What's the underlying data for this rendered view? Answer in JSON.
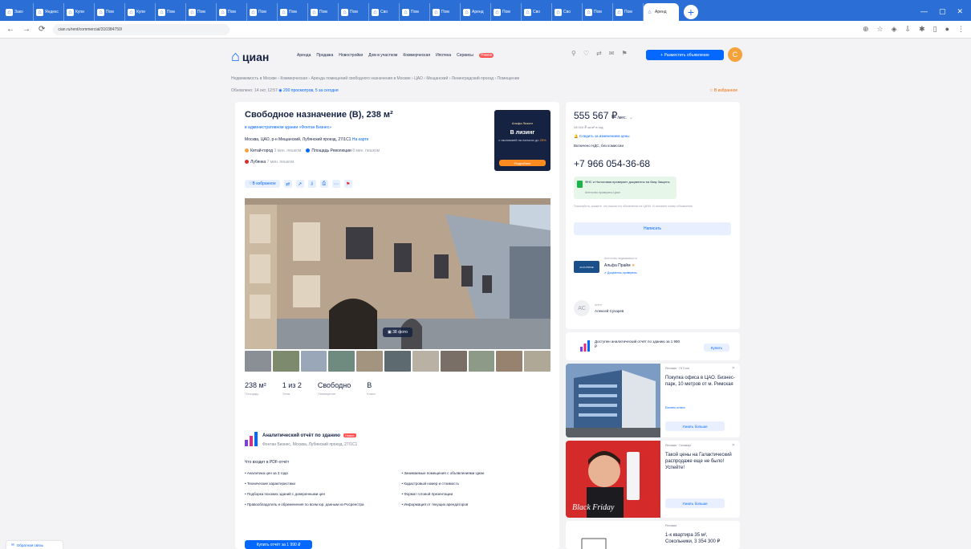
{
  "browser": {
    "tabs": [
      "Зако",
      "Яндекс",
      "Купи",
      "Пом",
      "Купи",
      "Пом",
      "Пом",
      "Пом",
      "Пом",
      "Пом",
      "Пом",
      "Пом",
      "Сво",
      "Пом",
      "Пом",
      "Аренд",
      "Пом",
      "Сво",
      "Сво",
      "Пом",
      "Пом",
      "Аренд"
    ],
    "url": "cian.ru/rent/commercial/310384750/"
  },
  "header": {
    "logo": "циан",
    "nav": [
      "Аренда",
      "Продажа",
      "Новостройки",
      "Дом в участком",
      "Коммерческая",
      "Ипотека",
      "Сервисы"
    ],
    "nav_hot": "Новое",
    "post_button": "+ Разместить объявление",
    "avatar": "С"
  },
  "breadcrumbs": "Недвижимость в Москве › Коммерческая › Аренда помещений свободного назначения в Москве › ЦАО › Мещанский › Ленинградский проезд › Помещение",
  "subcrumb_updated": "Обновлено: 14 окт, 12:57",
  "subcrumb_views": "200 просмотров, 5 за сегодня",
  "favorite_top": "В избранное",
  "listing": {
    "title": "Свободное назначение (В), 238 м²",
    "complex": "в административном здании «Фонтан Бизнес»",
    "address": "Москва, ЦАО, р-н Мещанский, Лубянский проезд, 27/1С1",
    "address_link": "На карте",
    "metro": [
      {
        "name": "Китай-город",
        "time": "3 мин. пешком",
        "color": "#f5a23a"
      },
      {
        "name": "Площадь Революции",
        "time": "8 мин. пешком",
        "color": "#0468ff"
      },
      {
        "name": "Лубянка",
        "time": "7 мин. пешком",
        "color": "#e02a2a"
      }
    ],
    "favorite_button": "В избранное",
    "photo_count": "38 фото",
    "facts": [
      {
        "value": "238 м²",
        "label": "Площадь"
      },
      {
        "value": "1 из 2",
        "label": "Этаж"
      },
      {
        "value": "Свободно",
        "label": "Помещение"
      },
      {
        "value": "B",
        "label": "Класс"
      }
    ]
  },
  "ad": {
    "brand": "Альфа Лизинг",
    "headline": "В лизинг",
    "text": "с экономией на налогах до",
    "highlight": "25%",
    "button": "Подробнее"
  },
  "report": {
    "title": "Аналитический отчёт по зданию",
    "badge": "Новое",
    "subtitle": "Фонтан Бизнес, Москва, Лубянский проезд, 27/1С1",
    "intro": "Что входит в PDF-отчёт",
    "left": [
      "• Аналитика цен за 3 года",
      "• Технические характеристики",
      "• Подборка похожих зданий с доверенными цен",
      "• Правообладатель и обременения по всем юр. данным из Росреестра"
    ],
    "right": [
      "• Занимаемые помещения с объявлениями Циан",
      "• Кадастровый номер и стоимость",
      "• Формат готовой презентации",
      "• Информация от текущих арендаторов"
    ],
    "button": "Купить отчёт за 1 990 ₽"
  },
  "sidebar": {
    "price": "555 567 ₽",
    "price_per": "/мес.",
    "price_sub": "28 010 ₽ за м² в год",
    "subscribe": "Следить за изменением цены",
    "vat": "Включено НДС, без комиссии",
    "phone": "+7 966 054-36-68",
    "security_title": "ФНС и Налоговая проверяет документы на базу Защиты",
    "security_sub": "Агентство проверено Циан",
    "note": "Пожалуйста, скажите, что нашли это объявление на ЦИАН. И назовите номер объявления",
    "write_button": "Написать",
    "agency_label": "Агентство недвижимости",
    "agency_logo": "ALFA PRIME",
    "agency_name": "Альфа Прайм",
    "agency_docs": "Документы проверены",
    "agent_label": "Агент",
    "agent_name": "Алексей Сухарев",
    "agent_avatar": "АС"
  },
  "report_cta": {
    "text": "Доступен аналитический отчёт по зданию за 1 990 ₽",
    "button": "Купить"
  },
  "promos": [
    {
      "label": "Реклама · ГК Сити",
      "title": "Покупка офиса в ЦАО. Бизнес-парк, 10 метров от м. Римская",
      "link": "Бизнес-класс",
      "button": "Узнать больше"
    },
    {
      "label": "Реклама · Галамарт",
      "title": "Такой цены на Галактический распродаже еще не было! Успейте!",
      "link": "",
      "button": "Узнать больше"
    },
    {
      "label": "Реклама",
      "title": "1-к квартира 35 м², Сокольники, 3 354 300 ₽"
    }
  ],
  "feedback": "Обратная связь"
}
